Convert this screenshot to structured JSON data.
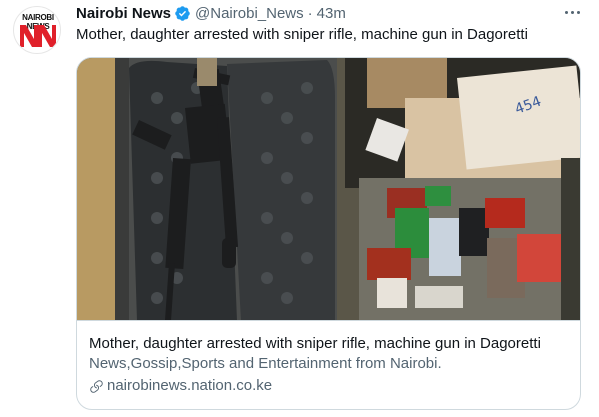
{
  "tweet": {
    "author_name": "Nairobi News",
    "handle": "@Nairobi_News",
    "separator": "·",
    "time": "43m",
    "text": "Mother, daughter arrested with sniper rifle, machine gun in Dagoretti",
    "avatar_label": "NAIROBI NEWS"
  },
  "card": {
    "title": "Mother, daughter arrested with sniper rifle, machine gun in Dagoretti",
    "description": "News,Gossip,Sports and Entertainment from Nairobi.",
    "domain": "nairobinews.nation.co.ke"
  },
  "colors": {
    "verified": "#1d9bf0",
    "brand_red": "#e0202a",
    "secondary_text": "#536471",
    "border": "#cfd9de"
  },
  "icons": [
    "verified-badge-icon",
    "more-options-icon",
    "link-icon"
  ]
}
